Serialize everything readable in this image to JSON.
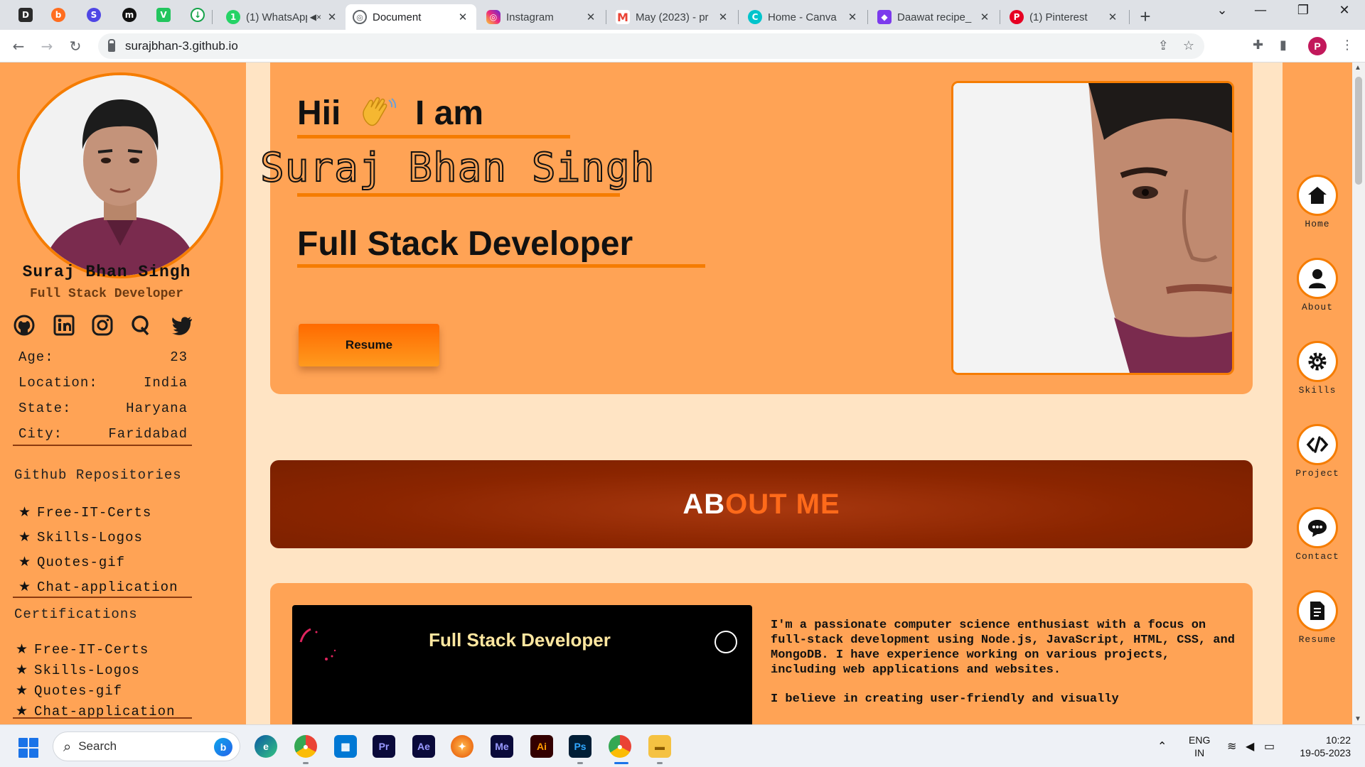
{
  "browser": {
    "tabs": [
      {
        "label": "(1) WhatsApp",
        "icon": "whatsapp-icon",
        "color": "#25d366"
      },
      {
        "label": "Document",
        "icon": "globe-icon",
        "color": "#5f6368",
        "active": true
      },
      {
        "label": "Instagram",
        "icon": "instagram-icon",
        "color": "#e1306c"
      },
      {
        "label": "May (2023) - pr",
        "icon": "gmail-icon",
        "color": "#ea4335"
      },
      {
        "label": "Home - Canva",
        "icon": "canva-icon",
        "color": "#00c4cc"
      },
      {
        "label": "Daawat recipe_",
        "icon": "chat-app-icon",
        "color": "#7c3aed"
      },
      {
        "label": "(1) Pinterest",
        "icon": "pinterest-icon",
        "color": "#e60023"
      }
    ],
    "url": "surajbhan-3.github.io",
    "profile_initial": "P"
  },
  "sidebar": {
    "name": "Suraj Bhan Singh",
    "role": "Full Stack Developer",
    "social": [
      "github-icon",
      "linkedin-icon",
      "instagram-icon",
      "quora-icon",
      "twitter-icon"
    ],
    "info": [
      {
        "label": "Age:",
        "value": "23"
      },
      {
        "label": "Location:",
        "value": "India"
      },
      {
        "label": "State:",
        "value": "Haryana"
      },
      {
        "label": "City:",
        "value": "Faridabad"
      }
    ],
    "repos_heading": "Github Repositories",
    "repos": [
      "Free-IT-Certs",
      "Skills-Logos",
      "Quotes-gif",
      "Chat-application"
    ],
    "certs_heading": "Certifications",
    "certs": [
      "Free-IT-Certs",
      "Skills-Logos",
      "Quotes-gif",
      "Chat-application"
    ]
  },
  "hero": {
    "greeting": "Hii",
    "greeting_tail": "I am",
    "name": "Suraj Bhan Singh",
    "title": "Full Stack Developer",
    "resume_label": "Resume"
  },
  "about": {
    "title_white": "AB",
    "title_orange": "OUT ME",
    "video_title": "Full  Stack Developer",
    "para1": "I'm a passionate computer science enthusiast with a focus on full-stack development using Node.js, JavaScript, HTML, CSS, and MongoDB. I have experience working on various projects, including web applications and websites.",
    "para2": "I believe in creating user-friendly and visually"
  },
  "rail": [
    {
      "label": "Home",
      "icon": "home-icon"
    },
    {
      "label": "About",
      "icon": "user-icon"
    },
    {
      "label": "Skills",
      "icon": "gear-icon"
    },
    {
      "label": "Project",
      "icon": "code-icon"
    },
    {
      "label": "Contact",
      "icon": "chat-icon"
    },
    {
      "label": "Resume",
      "icon": "document-icon"
    }
  ],
  "taskbar": {
    "search_label": "Search",
    "lang_top": "ENG",
    "lang_bottom": "IN",
    "time": "10:22",
    "date": "19-05-2023"
  },
  "colors": {
    "accent": "#f57c00",
    "panel": "#ffa355",
    "page_bg": "#ffe4c4",
    "about_banner": "#8b2500"
  }
}
